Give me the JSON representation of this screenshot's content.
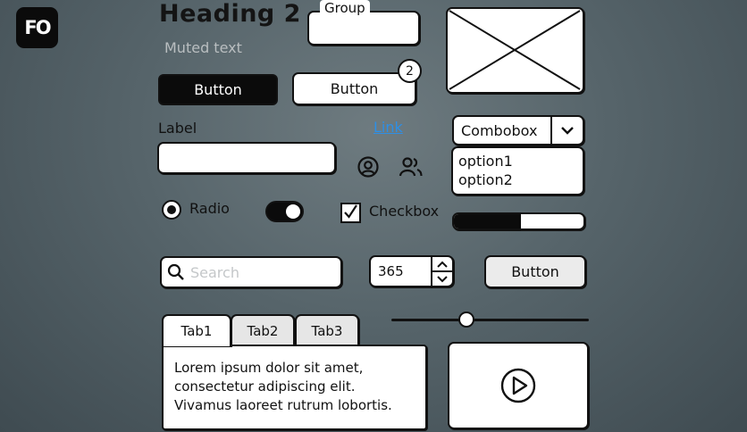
{
  "logo": {
    "text": "FO"
  },
  "heading": "Heading 2",
  "muted_text": "Muted text",
  "group": {
    "label": "Group"
  },
  "buttons": {
    "primary_label": "Button",
    "secondary_label": "Button",
    "secondary_badge": "2",
    "tertiary_label": "Button"
  },
  "field": {
    "label": "Label",
    "value": ""
  },
  "link": "Link",
  "combobox": {
    "value": "Combobox"
  },
  "listbox": {
    "options": [
      "option1",
      "option2"
    ]
  },
  "radio": {
    "label": "Radio",
    "selected": true
  },
  "toggle": {
    "on": true
  },
  "checkbox": {
    "label": "Checkbox",
    "checked": true
  },
  "progress": {
    "value": 0.52
  },
  "search": {
    "placeholder": "Search"
  },
  "stepper": {
    "value": "365"
  },
  "slider": {
    "value": 0.38
  },
  "tabs": [
    {
      "label": "Tab1"
    },
    {
      "label": "Tab2"
    },
    {
      "label": "Tab3"
    }
  ],
  "tab_content": {
    "lines": [
      "Lorem ipsum dolor sit amet,",
      "consectetur adipiscing elit.",
      "Vivamus laoreet rutrum lobortis."
    ]
  },
  "icons": [
    "user-circle-icon",
    "users-icon",
    "play-icon",
    "chevron-down-icon",
    "search-icon",
    "checkmark-icon"
  ]
}
